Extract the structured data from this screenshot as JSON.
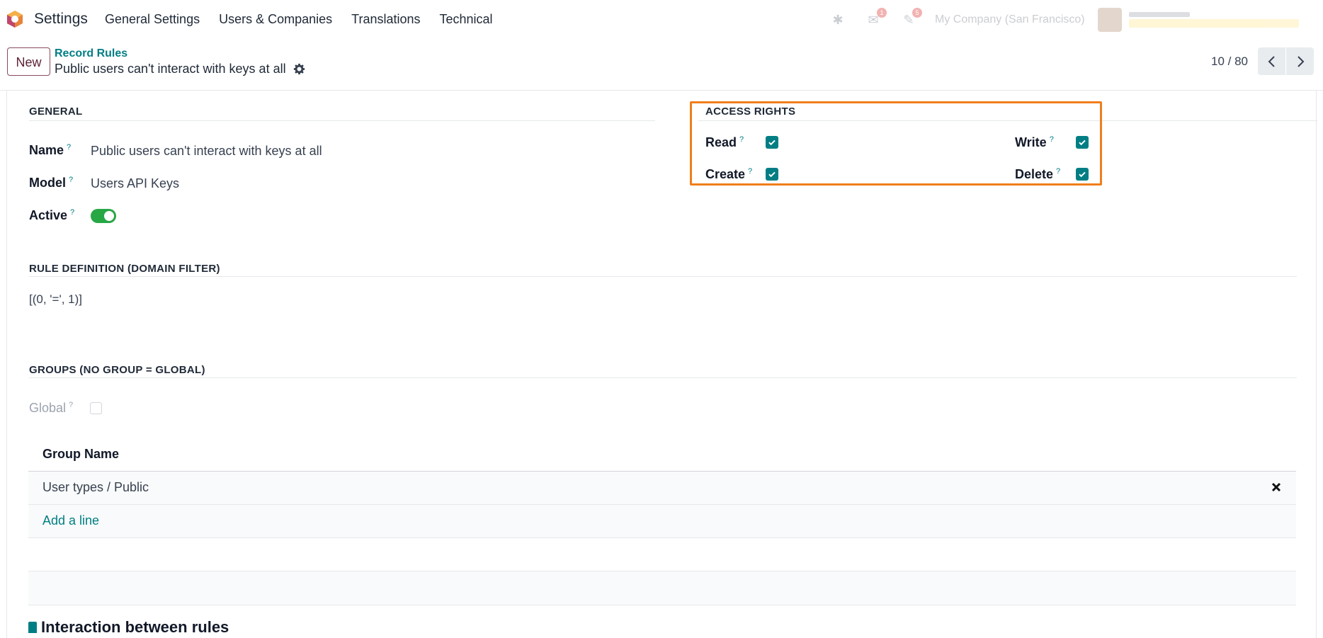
{
  "navbar": {
    "app_name": "Settings",
    "menu": [
      "General Settings",
      "Users & Companies",
      "Translations",
      "Technical"
    ],
    "company": "My Company (San Francisco)",
    "notification_badges": [
      "1",
      "5"
    ]
  },
  "control_panel": {
    "new_label": "New",
    "breadcrumb": "Record Rules",
    "record_title": "Public users can't interact with keys at all",
    "pager": "10 / 80"
  },
  "general": {
    "title": "GENERAL",
    "name_label": "Name",
    "name_value": "Public users can't interact with keys at all",
    "model_label": "Model",
    "model_value": "Users API Keys",
    "active_label": "Active",
    "help": "?"
  },
  "access_rights": {
    "title": "ACCESS RIGHTS",
    "read_label": "Read",
    "write_label": "Write",
    "create_label": "Create",
    "delete_label": "Delete"
  },
  "rule_definition": {
    "title": "RULE DEFINITION (DOMAIN FILTER)",
    "domain": "[(0, '=', 1)]"
  },
  "groups": {
    "title": "GROUPS (NO GROUP = GLOBAL)",
    "global_label": "Global",
    "column_header": "Group Name",
    "rows": [
      "User types / Public"
    ],
    "add_line": "Add a line"
  },
  "bottom": {
    "heading": "Interaction between rules"
  },
  "colors": {
    "accent": "#017e84",
    "highlight": "#f07e1b",
    "toggle_on": "#28a745",
    "brand": "#714b67"
  }
}
